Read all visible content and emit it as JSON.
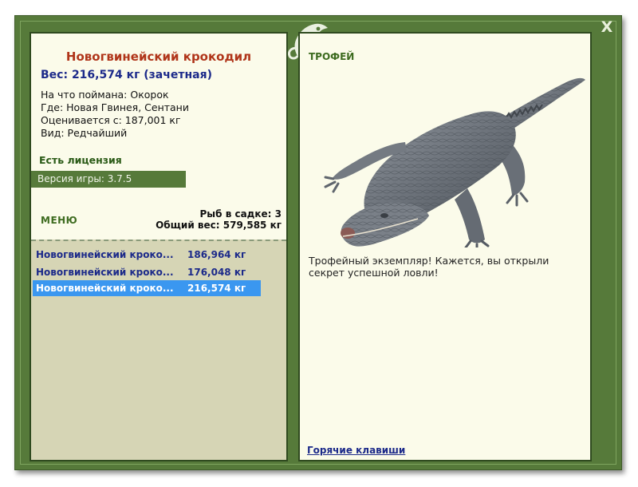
{
  "window": {
    "close_label": "X"
  },
  "fish": {
    "title": "Новогвинейский крокодил",
    "weight_line": "Вес: 216,574 кг (зачетная)",
    "bait": "На что поймана: Окорок",
    "location": "Где: Новая Гвинея, Сентани",
    "valued_from": "Оценивается с: 187,001 кг",
    "kind": "Вид: Редчайший"
  },
  "license": "Есть лицензия",
  "version": "Версия игры: 3.7.5",
  "menu_label": "МЕНЮ",
  "keepnet": {
    "count": "Рыб в садке: 3",
    "total_weight": "Общий вес: 579,585 кг"
  },
  "catches": [
    {
      "name": "Новогвинейский кроко...",
      "weight": "186,964 кг",
      "selected": false
    },
    {
      "name": "Новогвинейский кроко...",
      "weight": "176,048 кг",
      "selected": false
    },
    {
      "name": "Новогвинейский кроко...",
      "weight": "216,574 кг",
      "selected": true
    }
  ],
  "trophy": {
    "label": "ТРОФЕЙ",
    "text": "Трофейный экземпляр! Кажется, вы открыли секрет успешной ловли!"
  },
  "hotkeys_label": "Горячие клавиши",
  "colors": {
    "frame": "#567a3a",
    "panel": "#fbfbea",
    "selection": "#3a97f0",
    "title_red": "#b0351a",
    "text_blue": "#1c2a8a"
  }
}
